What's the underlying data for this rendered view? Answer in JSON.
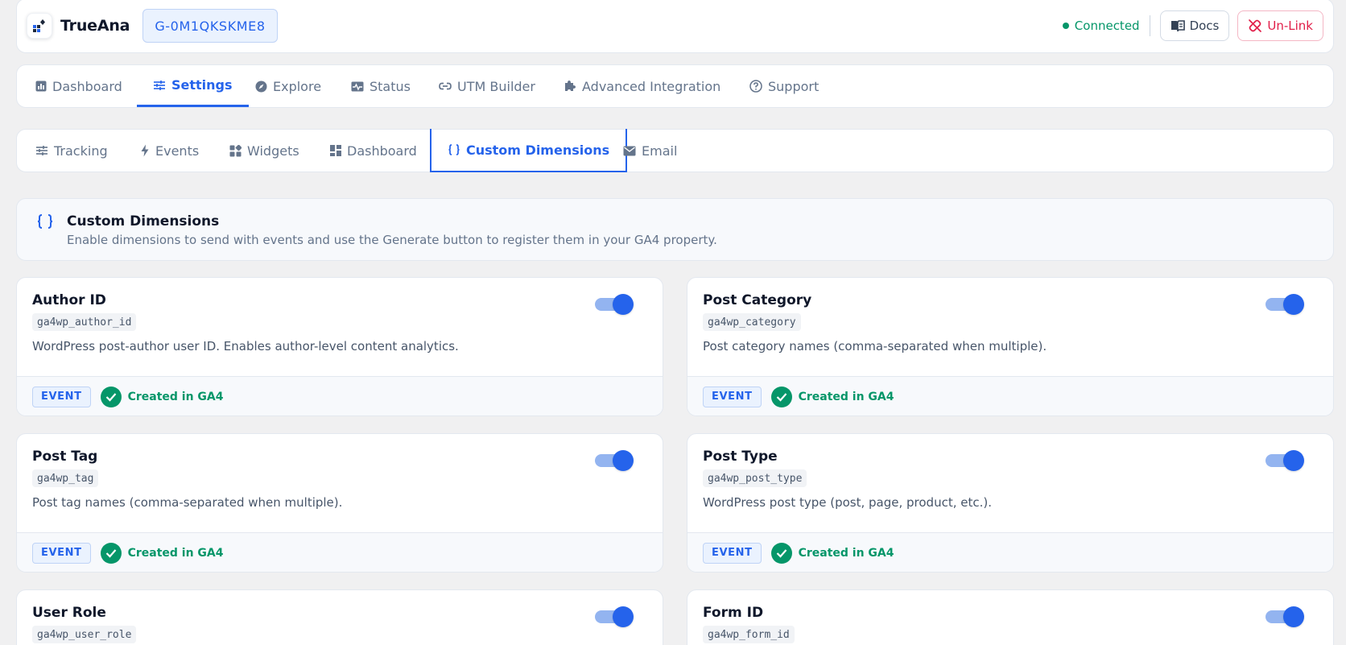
{
  "header": {
    "brand": "TrueAna",
    "measurement_id": "G-0M1QKSKME8",
    "status": "Connected",
    "docs_label": "Docs",
    "unlink_label": "Un-Link"
  },
  "main_tabs": [
    {
      "label": "Dashboard",
      "icon": "chart-icon"
    },
    {
      "label": "Settings",
      "icon": "sliders-icon",
      "active": true
    },
    {
      "label": "Explore",
      "icon": "compass-icon"
    },
    {
      "label": "Status",
      "icon": "status-icon"
    },
    {
      "label": "UTM Builder",
      "icon": "link-icon"
    },
    {
      "label": "Advanced Integration",
      "icon": "puzzle-icon"
    },
    {
      "label": "Support",
      "icon": "help-icon"
    }
  ],
  "sub_tabs": [
    {
      "label": "Tracking",
      "icon": "sliders-icon"
    },
    {
      "label": "Events",
      "icon": "bolt-icon"
    },
    {
      "label": "Widgets",
      "icon": "widgets-icon"
    },
    {
      "label": "Dashboard",
      "icon": "dashboard-icon"
    },
    {
      "label": "Custom Dimensions",
      "icon": "braces-icon",
      "active": true
    },
    {
      "label": "Email",
      "icon": "mail-icon"
    }
  ],
  "section": {
    "title": "Custom Dimensions",
    "description": "Enable dimensions to send with events and use the Generate button to register them in your GA4 property."
  },
  "cards": [
    {
      "title": "Author ID",
      "code": "ga4wp_author_id",
      "description": "WordPress post-author user ID. Enables author-level content analytics.",
      "scope": "EVENT",
      "status": "Created in GA4",
      "enabled": true
    },
    {
      "title": "Post Category",
      "code": "ga4wp_category",
      "description": "Post category names (comma-separated when multiple).",
      "scope": "EVENT",
      "status": "Created in GA4",
      "enabled": true
    },
    {
      "title": "Post Tag",
      "code": "ga4wp_tag",
      "description": "Post tag names (comma-separated when multiple).",
      "scope": "EVENT",
      "status": "Created in GA4",
      "enabled": true
    },
    {
      "title": "Post Type",
      "code": "ga4wp_post_type",
      "description": "WordPress post type (post, page, product, etc.).",
      "scope": "EVENT",
      "status": "Created in GA4",
      "enabled": true
    },
    {
      "title": "User Role",
      "code": "ga4wp_user_role",
      "description": "",
      "scope": "",
      "status": "",
      "enabled": true
    },
    {
      "title": "Form ID",
      "code": "ga4wp_form_id",
      "description": "",
      "scope": "",
      "status": "",
      "enabled": true
    }
  ],
  "colors": {
    "accent": "#2563eb",
    "success": "#059669",
    "danger": "#e11d48"
  }
}
